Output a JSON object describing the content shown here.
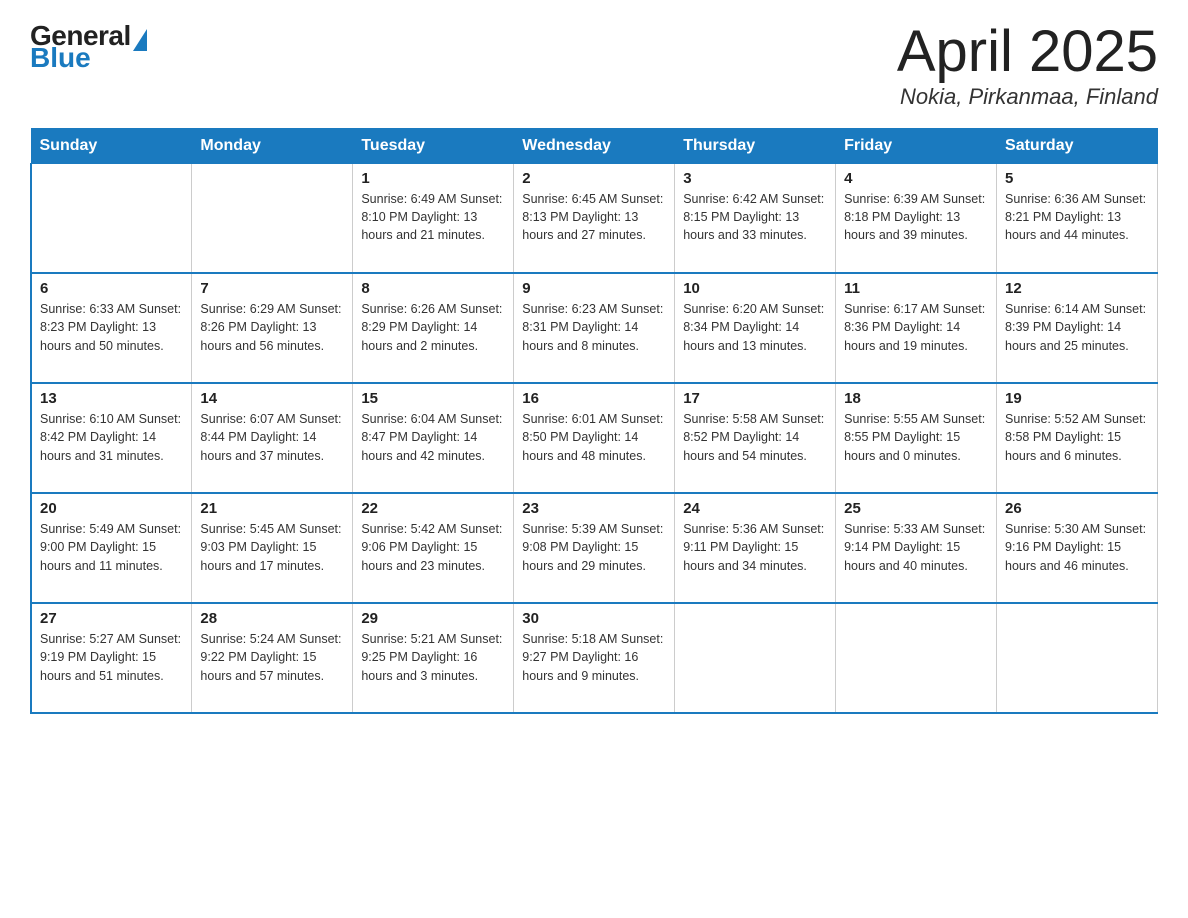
{
  "logo": {
    "general": "General",
    "blue": "Blue"
  },
  "title": "April 2025",
  "location": "Nokia, Pirkanmaa, Finland",
  "days_of_week": [
    "Sunday",
    "Monday",
    "Tuesday",
    "Wednesday",
    "Thursday",
    "Friday",
    "Saturday"
  ],
  "weeks": [
    [
      {
        "day": "",
        "info": ""
      },
      {
        "day": "",
        "info": ""
      },
      {
        "day": "1",
        "info": "Sunrise: 6:49 AM\nSunset: 8:10 PM\nDaylight: 13 hours\nand 21 minutes."
      },
      {
        "day": "2",
        "info": "Sunrise: 6:45 AM\nSunset: 8:13 PM\nDaylight: 13 hours\nand 27 minutes."
      },
      {
        "day": "3",
        "info": "Sunrise: 6:42 AM\nSunset: 8:15 PM\nDaylight: 13 hours\nand 33 minutes."
      },
      {
        "day": "4",
        "info": "Sunrise: 6:39 AM\nSunset: 8:18 PM\nDaylight: 13 hours\nand 39 minutes."
      },
      {
        "day": "5",
        "info": "Sunrise: 6:36 AM\nSunset: 8:21 PM\nDaylight: 13 hours\nand 44 minutes."
      }
    ],
    [
      {
        "day": "6",
        "info": "Sunrise: 6:33 AM\nSunset: 8:23 PM\nDaylight: 13 hours\nand 50 minutes."
      },
      {
        "day": "7",
        "info": "Sunrise: 6:29 AM\nSunset: 8:26 PM\nDaylight: 13 hours\nand 56 minutes."
      },
      {
        "day": "8",
        "info": "Sunrise: 6:26 AM\nSunset: 8:29 PM\nDaylight: 14 hours\nand 2 minutes."
      },
      {
        "day": "9",
        "info": "Sunrise: 6:23 AM\nSunset: 8:31 PM\nDaylight: 14 hours\nand 8 minutes."
      },
      {
        "day": "10",
        "info": "Sunrise: 6:20 AM\nSunset: 8:34 PM\nDaylight: 14 hours\nand 13 minutes."
      },
      {
        "day": "11",
        "info": "Sunrise: 6:17 AM\nSunset: 8:36 PM\nDaylight: 14 hours\nand 19 minutes."
      },
      {
        "day": "12",
        "info": "Sunrise: 6:14 AM\nSunset: 8:39 PM\nDaylight: 14 hours\nand 25 minutes."
      }
    ],
    [
      {
        "day": "13",
        "info": "Sunrise: 6:10 AM\nSunset: 8:42 PM\nDaylight: 14 hours\nand 31 minutes."
      },
      {
        "day": "14",
        "info": "Sunrise: 6:07 AM\nSunset: 8:44 PM\nDaylight: 14 hours\nand 37 minutes."
      },
      {
        "day": "15",
        "info": "Sunrise: 6:04 AM\nSunset: 8:47 PM\nDaylight: 14 hours\nand 42 minutes."
      },
      {
        "day": "16",
        "info": "Sunrise: 6:01 AM\nSunset: 8:50 PM\nDaylight: 14 hours\nand 48 minutes."
      },
      {
        "day": "17",
        "info": "Sunrise: 5:58 AM\nSunset: 8:52 PM\nDaylight: 14 hours\nand 54 minutes."
      },
      {
        "day": "18",
        "info": "Sunrise: 5:55 AM\nSunset: 8:55 PM\nDaylight: 15 hours\nand 0 minutes."
      },
      {
        "day": "19",
        "info": "Sunrise: 5:52 AM\nSunset: 8:58 PM\nDaylight: 15 hours\nand 6 minutes."
      }
    ],
    [
      {
        "day": "20",
        "info": "Sunrise: 5:49 AM\nSunset: 9:00 PM\nDaylight: 15 hours\nand 11 minutes."
      },
      {
        "day": "21",
        "info": "Sunrise: 5:45 AM\nSunset: 9:03 PM\nDaylight: 15 hours\nand 17 minutes."
      },
      {
        "day": "22",
        "info": "Sunrise: 5:42 AM\nSunset: 9:06 PM\nDaylight: 15 hours\nand 23 minutes."
      },
      {
        "day": "23",
        "info": "Sunrise: 5:39 AM\nSunset: 9:08 PM\nDaylight: 15 hours\nand 29 minutes."
      },
      {
        "day": "24",
        "info": "Sunrise: 5:36 AM\nSunset: 9:11 PM\nDaylight: 15 hours\nand 34 minutes."
      },
      {
        "day": "25",
        "info": "Sunrise: 5:33 AM\nSunset: 9:14 PM\nDaylight: 15 hours\nand 40 minutes."
      },
      {
        "day": "26",
        "info": "Sunrise: 5:30 AM\nSunset: 9:16 PM\nDaylight: 15 hours\nand 46 minutes."
      }
    ],
    [
      {
        "day": "27",
        "info": "Sunrise: 5:27 AM\nSunset: 9:19 PM\nDaylight: 15 hours\nand 51 minutes."
      },
      {
        "day": "28",
        "info": "Sunrise: 5:24 AM\nSunset: 9:22 PM\nDaylight: 15 hours\nand 57 minutes."
      },
      {
        "day": "29",
        "info": "Sunrise: 5:21 AM\nSunset: 9:25 PM\nDaylight: 16 hours\nand 3 minutes."
      },
      {
        "day": "30",
        "info": "Sunrise: 5:18 AM\nSunset: 9:27 PM\nDaylight: 16 hours\nand 9 minutes."
      },
      {
        "day": "",
        "info": ""
      },
      {
        "day": "",
        "info": ""
      },
      {
        "day": "",
        "info": ""
      }
    ]
  ]
}
